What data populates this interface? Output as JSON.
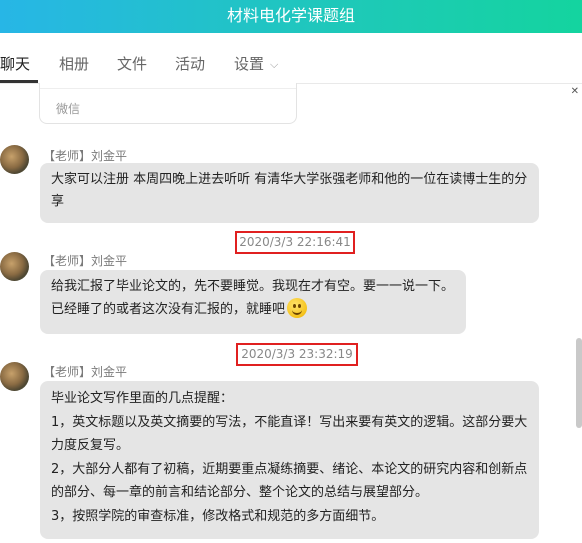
{
  "window": {
    "title": "材料电化学课题组"
  },
  "tabs": [
    {
      "label": "聊天",
      "active": true
    },
    {
      "label": "相册"
    },
    {
      "label": "文件"
    },
    {
      "label": "活动"
    },
    {
      "label": "设置"
    }
  ],
  "prev_card": {
    "label": "微信"
  },
  "messages": [
    {
      "sender": "【老师】刘金平",
      "lines": [
        "大家可以注册 本周四晚上进去听听 有清华大学张强老师和他的一位在读博士生的分享"
      ]
    },
    {
      "timestamp": "2020/3/3 22:16:41",
      "sender": "【老师】刘金平",
      "lines": [
        "给我汇报了毕业论文的，先不要睡觉。我现在才有空。要一一说一下。",
        "已经睡了的或者这次没有汇报的，就睡吧"
      ]
    },
    {
      "timestamp": "2020/3/3 23:32:19",
      "sender": "【老师】刘金平",
      "lines": [
        "毕业论文写作里面的几点提醒：",
        "1，英文标题以及英文摘要的写法，不能直译！写出来要有英文的逻辑。这部分要大力度反复写。",
        "2，大部分人都有了初稿，近期要重点凝练摘要、绪论、本论文的研究内容和创新点的部分、每一章的前言和结论部分、整个论文的总结与展望部分。",
        "3，按照学院的审查标准，修改格式和规范的多方面细节。"
      ]
    }
  ],
  "colors": {
    "header_start": "#27b6e6",
    "header_end": "#14d49f",
    "highlight_box": "#e02020",
    "bubble": "#e5e5e5"
  },
  "icons": [
    "chevron-down-icon",
    "close-icon",
    "smiley-emoji-icon"
  ]
}
